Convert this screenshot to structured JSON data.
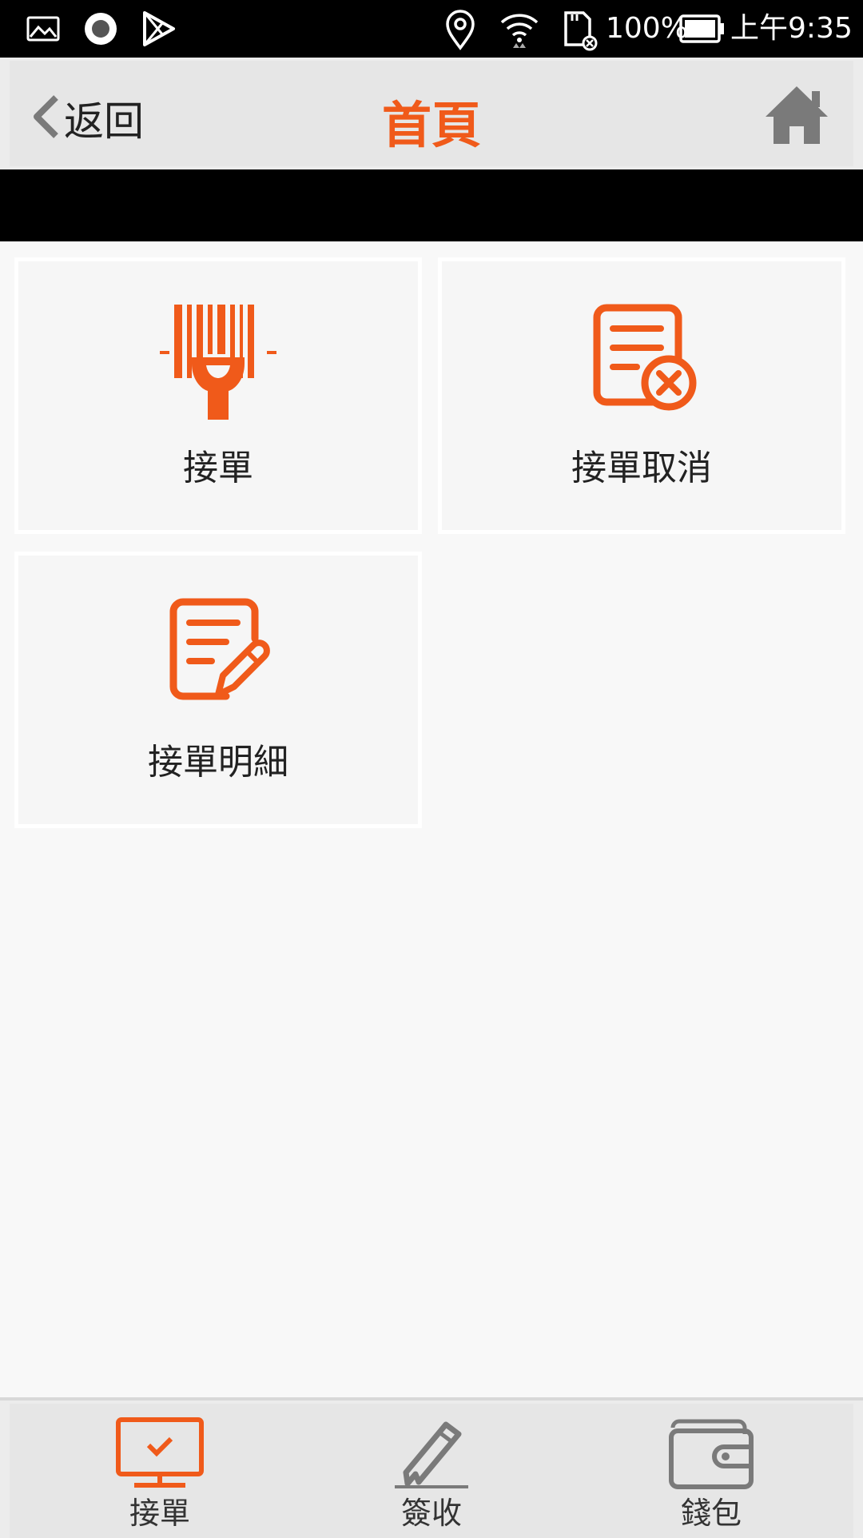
{
  "status_bar": {
    "icons": [
      "gallery-icon",
      "record-icon",
      "play-store-icon",
      "location-icon",
      "wifi-icon",
      "sd-card-icon",
      "battery-icon"
    ],
    "battery": "100%",
    "time": "上午9:35"
  },
  "header": {
    "back_label": "返回",
    "title": "首頁",
    "home_icon": "home-icon"
  },
  "colors": {
    "accent": "#f05a1a",
    "icon_gray": "#7a7a7a",
    "status_bg": "#000000"
  },
  "tiles": [
    {
      "label": "接單",
      "icon": "barcode-scanner-icon"
    },
    {
      "label": "接單取消",
      "icon": "document-cancel-icon"
    },
    {
      "label": "接單明細",
      "icon": "document-edit-icon"
    }
  ],
  "bottom_nav": {
    "tabs": [
      {
        "label": "接單",
        "icon": "monitor-check-icon",
        "active": true
      },
      {
        "label": "簽收",
        "icon": "pen-sign-icon",
        "active": false
      },
      {
        "label": "錢包",
        "icon": "wallet-icon",
        "active": false
      }
    ]
  }
}
